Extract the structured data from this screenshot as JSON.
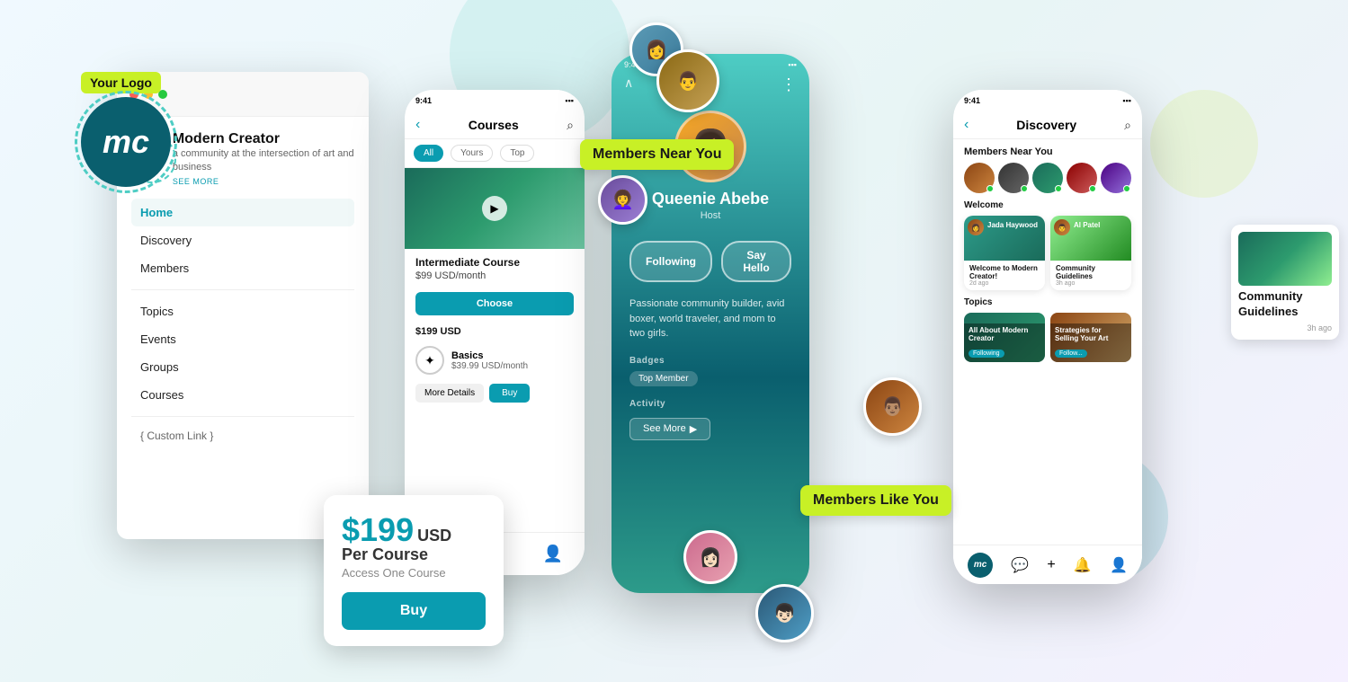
{
  "logo": {
    "label": "Your Logo",
    "mc_text": "mc"
  },
  "web_panel": {
    "community_name": "Modern Creator",
    "community_desc": "a community at the intersection of art and business",
    "see_more": "SEE MORE",
    "nav_items": [
      {
        "label": "Home",
        "active": true
      },
      {
        "label": "Discovery",
        "active": false
      },
      {
        "label": "Members",
        "active": false
      },
      {
        "label": "Topics",
        "active": false
      },
      {
        "label": "Events",
        "active": false
      },
      {
        "label": "Groups",
        "active": false
      },
      {
        "label": "Courses",
        "active": false
      }
    ],
    "custom_link": "{ Custom Link }"
  },
  "phone_courses": {
    "status_time": "9:41",
    "title": "Courses",
    "tabs": [
      "All",
      "Yours",
      "Top"
    ],
    "active_tab": "All",
    "course1": {
      "title": "Intermediate Course",
      "price": "$99 USD/month",
      "cta": "Choose"
    },
    "price_display": "$199 USD",
    "course2": {
      "title": "Basics",
      "price": "$39.99 USD/month",
      "btn1": "More Details",
      "btn2": "Buy"
    }
  },
  "phone_profile": {
    "status_time": "9:41",
    "name": "Queenie Abebe",
    "role": "Host",
    "btn_following": "Following",
    "btn_say_hello": "Say Hello",
    "bio": "Passionate community builder, avid boxer, world traveler, and mom to two girls.",
    "badges_label": "Badges",
    "badges": [
      "Top Member"
    ],
    "activity_label": "Activity",
    "see_more": "See More"
  },
  "phone_discovery": {
    "status_time": "9:41",
    "title": "Discovery",
    "members_near_label": "Members Near You",
    "welcome_label": "Welcome",
    "welcome_cards": [
      {
        "author": "Jada Haywood",
        "title": "Welcome to Modern Creator!",
        "time": "2d ago"
      },
      {
        "author": "Al Patel",
        "title": "Community Guidelines",
        "time": "3h ago"
      }
    ],
    "topics_label": "Topics",
    "topics": [
      {
        "name": "All About Modern Creator",
        "follow": "Following"
      },
      {
        "name": "Strategies for Selling Your Art",
        "follow": "Follow..."
      }
    ]
  },
  "callouts": {
    "members_near": "Members Near You",
    "members_like": "Members Like You"
  },
  "pricing": {
    "amount": "$199",
    "currency": "USD",
    "label": "Per Course",
    "access": "Access One Course",
    "buy": "Buy"
  },
  "icons": {
    "back": "‹",
    "search": "⌕",
    "dots": "⋮",
    "plus": "+",
    "bell": "🔔",
    "person": "👤",
    "home": "⊞",
    "chat": "💬",
    "right_arrow": "▶"
  }
}
